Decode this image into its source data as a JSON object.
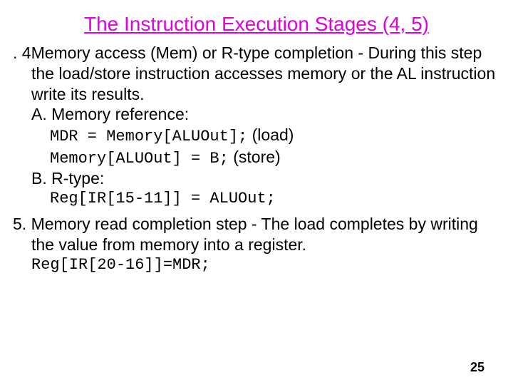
{
  "title": "The Instruction Execution Stages (4, 5)",
  "stage4": {
    "line1": ". 4Memory access (Mem) or R-type completion - During this step the load/store instruction accesses memory or the AL instruction write its results.",
    "refA_label": "A. Memory reference:",
    "codeA1_mono": "MDR = Memory[ALUOut];",
    "codeA1_note": " (load)",
    "codeA2_mono": "Memory[ALUOut] = B;",
    "codeA2_note": " (store)",
    "refB_label": "B. R-type:",
    "codeB": "Reg[IR[15-11]] = ALUOut;"
  },
  "stage5": {
    "text": "5. Memory read completion step - The load completes by writing the value from memory into a register.",
    "code": "Reg[IR[20-16]]=MDR;"
  },
  "page": "25"
}
